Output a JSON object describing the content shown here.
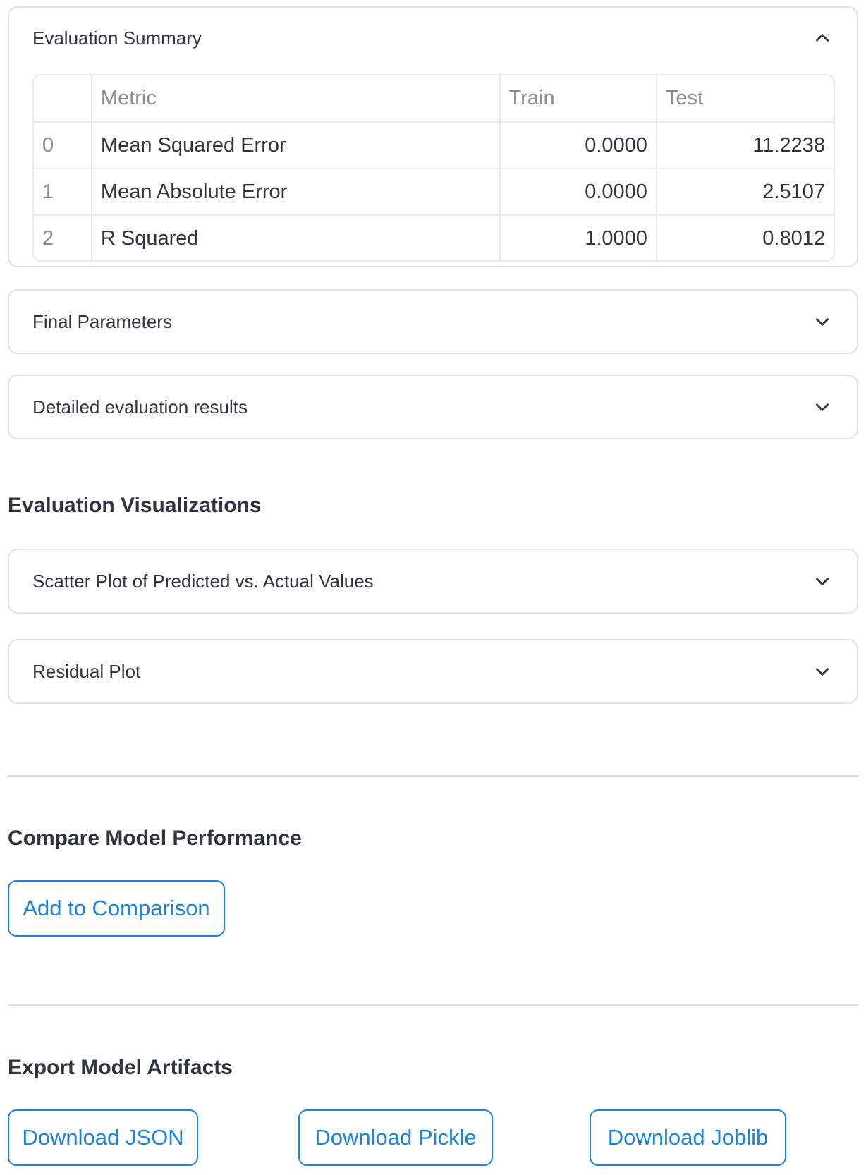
{
  "summary": {
    "title": "Evaluation Summary",
    "columns": [
      "",
      "Metric",
      "Train",
      "Test"
    ],
    "rows": [
      {
        "index": "0",
        "metric": "Mean Squared Error",
        "train": "0.0000",
        "test": "11.2238"
      },
      {
        "index": "1",
        "metric": "Mean Absolute Error",
        "train": "0.0000",
        "test": "2.5107"
      },
      {
        "index": "2",
        "metric": "R Squared",
        "train": "1.0000",
        "test": "0.8012"
      }
    ]
  },
  "expanders": {
    "final_parameters": "Final Parameters",
    "detailed_results": "Detailed evaluation results",
    "scatter_plot": "Scatter Plot of Predicted vs. Actual Values",
    "residual_plot": "Residual Plot"
  },
  "headings": {
    "visualizations": "Evaluation Visualizations",
    "compare": "Compare Model Performance",
    "export": "Export Model Artifacts"
  },
  "buttons": {
    "add_comparison": "Add to Comparison",
    "download_json": "Download JSON",
    "download_pickle": "Download Pickle",
    "download_joblib": "Download Joblib"
  },
  "colors": {
    "accent": "#1c83e1",
    "text": "#31333f",
    "muted": "#8a8c94",
    "border": "#e0e2e6"
  }
}
